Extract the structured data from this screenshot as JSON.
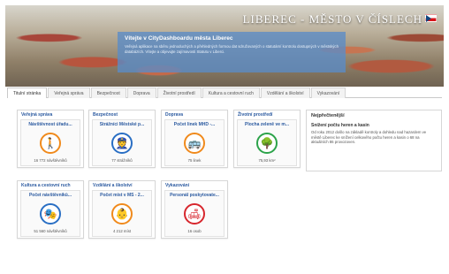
{
  "header": {
    "city_title": "LIBEREC - MĚSTO V ČÍSLECH",
    "welcome_title": "Vítejte v CityDashboardu města Liberec",
    "welcome_text": "Veřejná aplikace na sběru jednoduchých a přehledných formou dat sdružovaných o statutární kontrolu dostupných v městských databázích. Vítejte a objevujte zajímavosti Statutu v Liberci."
  },
  "tabs": [
    {
      "label": "Titulní stránka",
      "active": true
    },
    {
      "label": "Veřejná správa",
      "active": false
    },
    {
      "label": "Bezpečnost",
      "active": false
    },
    {
      "label": "Doprava",
      "active": false
    },
    {
      "label": "Životní prostředí",
      "active": false
    },
    {
      "label": "Kultura a cestovní ruch",
      "active": false
    },
    {
      "label": "Vzdělání a školství",
      "active": false
    },
    {
      "label": "Vykazování",
      "active": false
    }
  ],
  "tiles": [
    {
      "category": "Veřejná správa",
      "heading": "Návštěvnost úřadu...",
      "icon": "walking-person-icon",
      "icon_glyph": "🚶",
      "color": "#f08a1c",
      "value": "16 772 návštěvníků"
    },
    {
      "category": "Bezpečnost",
      "heading": "Strážníci Městské p...",
      "icon": "police-officer-icon",
      "icon_glyph": "👮",
      "color": "#2a6fc4",
      "value": "77 strážníků"
    },
    {
      "category": "Doprava",
      "heading": "Počet linek MHD -...",
      "icon": "bus-icon",
      "icon_glyph": "🚌",
      "color": "#f08a1c",
      "value": "75 linek"
    },
    {
      "category": "Životní prostředí",
      "heading": "Plocha zeleně ve m...",
      "icon": "tree-icon",
      "icon_glyph": "🌳",
      "color": "#2ca34a",
      "value": "75,93 km²"
    },
    {
      "category": "Kultura a cestovní ruch",
      "heading": "Počet návštěvníků...",
      "icon": "theater-masks-icon",
      "icon_glyph": "🎭",
      "color": "#2a6fc4",
      "value": "51 560 návštěvníků"
    },
    {
      "category": "Vzdělání a školství",
      "heading": "Počet míst v MŠ - 2...",
      "icon": "children-icon",
      "icon_glyph": "👶",
      "color": "#f08a1c",
      "value": "4 212 míst"
    },
    {
      "category": "Vykazování",
      "heading": "Personál poskytovate...",
      "icon": "armchair-icon",
      "icon_glyph": "🛋",
      "color": "#d7262d",
      "value": "16 osob"
    }
  ],
  "news": {
    "title": "Nejpřečtenější",
    "headline": "Snížení počtu heren a kasin",
    "text": "Od roku 2012 došlo na základě kontroly a dohledu nad hazardem ve městě Liberec ke snížení celkového počtu heren a kasin o 68 na aktuálních 86 provozoven."
  }
}
